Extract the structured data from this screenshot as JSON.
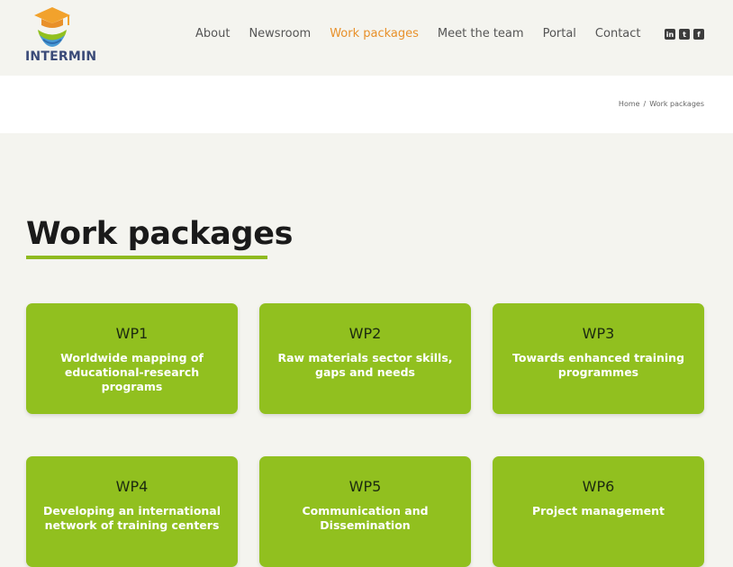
{
  "brand": {
    "name": "INTERMIN"
  },
  "nav": {
    "items": [
      {
        "label": "About"
      },
      {
        "label": "Newsroom"
      },
      {
        "label": "Work packages"
      },
      {
        "label": "Meet the team"
      },
      {
        "label": "Portal"
      },
      {
        "label": "Contact"
      }
    ],
    "active": "Work packages"
  },
  "social": [
    {
      "icon": "linkedin-icon",
      "glyph": "in"
    },
    {
      "icon": "twitter-icon",
      "glyph": "t"
    },
    {
      "icon": "facebook-icon",
      "glyph": "f"
    }
  ],
  "breadcrumb": {
    "home": "Home",
    "separator": "/",
    "current": "Work packages"
  },
  "page": {
    "title": "Work packages"
  },
  "packages": [
    {
      "code": "WP1",
      "title": "Worldwide mapping of educational-research programs"
    },
    {
      "code": "WP2",
      "title": "Raw materials sector skills, gaps and needs"
    },
    {
      "code": "WP3",
      "title": "Towards enhanced training programmes"
    },
    {
      "code": "WP4",
      "title": "Developing an international network of training centers"
    },
    {
      "code": "WP5",
      "title": "Communication and Dissemination"
    },
    {
      "code": "WP6",
      "title": "Project management"
    }
  ],
  "colors": {
    "accent": "#e8902a",
    "card": "#91c01f",
    "underline": "#8fba1f",
    "logo_text": "#3a4a78"
  }
}
